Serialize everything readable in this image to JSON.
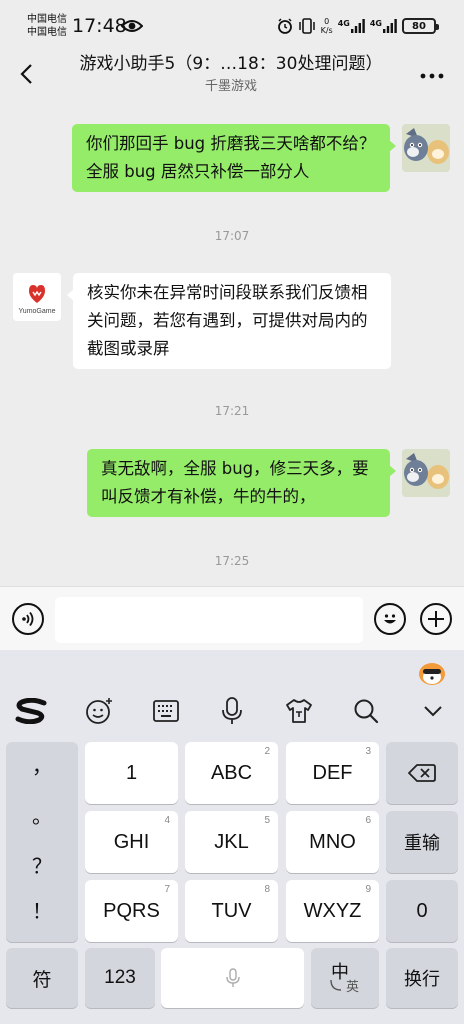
{
  "status_bar": {
    "carrier_line1": "中国电信",
    "carrier_line2": "中国电信",
    "time": "17:48",
    "net_speed_value": "0",
    "net_speed_unit": "K/s",
    "network1": "4G",
    "network2": "4G",
    "battery": "80"
  },
  "nav": {
    "title": "游戏小助手5（9：…18：30处理问题）",
    "subtitle": "千墨游戏"
  },
  "messages": [
    {
      "sender": "me",
      "text": "你们那回手 bug 折磨我三天啥都不给？全服 bug 居然只补偿一部分人"
    },
    {
      "type": "time",
      "text": "17:07"
    },
    {
      "sender": "other",
      "avatar_text": "YumoGame",
      "text": "核实你未在异常时间段联系我们反馈相关问题，若您有遇到，可提供对局内的截图或录屏"
    },
    {
      "type": "time",
      "text": "17:21"
    },
    {
      "sender": "me",
      "text": "真无敌啊，全服 bug，修三天多，要叫反馈才有补偿，牛的牛的，"
    },
    {
      "type": "time",
      "text": "17:25"
    }
  ],
  "input": {
    "placeholder": ""
  },
  "keyboard": {
    "side_keys": [
      "，",
      "。",
      "？",
      "！"
    ],
    "keys": [
      {
        "label": "1",
        "sub": ""
      },
      {
        "label": "ABC",
        "sub": "2"
      },
      {
        "label": "DEF",
        "sub": "3"
      },
      {
        "label": "GHI",
        "sub": "4"
      },
      {
        "label": "JKL",
        "sub": "5"
      },
      {
        "label": "MNO",
        "sub": "6"
      },
      {
        "label": "PQRS",
        "sub": "7"
      },
      {
        "label": "TUV",
        "sub": "8"
      },
      {
        "label": "WXYZ",
        "sub": "9"
      },
      {
        "label": "0",
        "sub": ""
      }
    ],
    "reenter_label": "重输",
    "symbol_label": "符",
    "num_label": "123",
    "lang_main": "中",
    "lang_alt": "英",
    "enter_label": "换行"
  },
  "colors": {
    "my_bubble": "#95ec69",
    "other_bubble": "#ffffff",
    "background": "#ededed"
  }
}
